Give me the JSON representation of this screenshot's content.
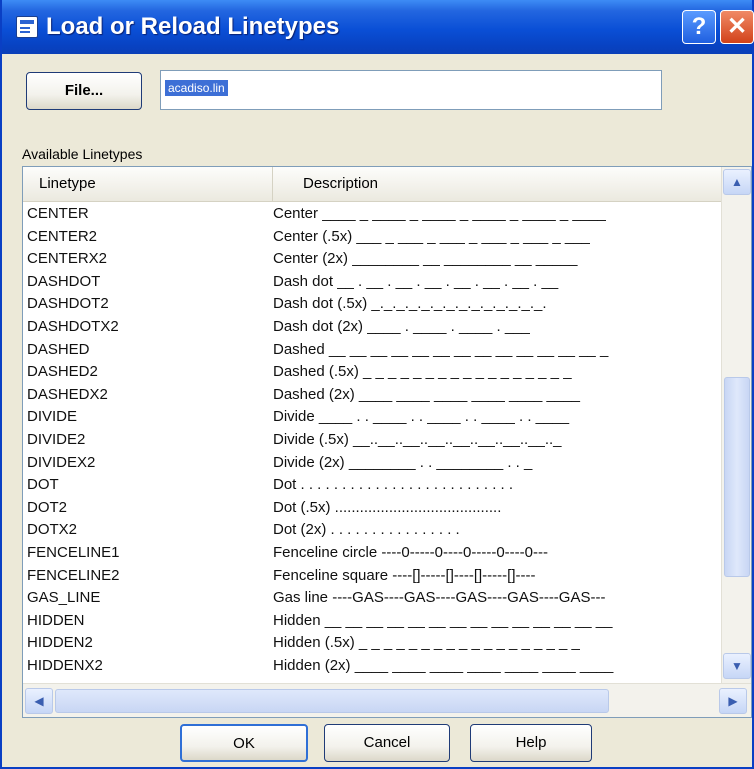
{
  "window": {
    "title": "Load or Reload Linetypes",
    "help_glyph": "?",
    "close_glyph": "✕"
  },
  "file": {
    "button_label": "File...",
    "value": "acadiso.lin"
  },
  "available_label": "Available Linetypes",
  "table": {
    "headers": [
      "Linetype",
      "Description"
    ],
    "rows": [
      {
        "name": "CENTER",
        "desc": "Center ____ _ ____ _ ____ _ ____ _ ____ _ ____"
      },
      {
        "name": "CENTER2",
        "desc": "Center (.5x) ___ _ ___ _ ___ _ ___ _ ___ _ ___"
      },
      {
        "name": "CENTERX2",
        "desc": "Center (2x) ________ __ ________ __ _____"
      },
      {
        "name": "DASHDOT",
        "desc": "Dash dot __ . __ . __ . __ . __ . __ . __ . __"
      },
      {
        "name": "DASHDOT2",
        "desc": "Dash dot (.5x) _._._._._._._._._._._._._._."
      },
      {
        "name": "DASHDOTX2",
        "desc": "Dash dot (2x) ____ . ____ . ____ . ___"
      },
      {
        "name": "DASHED",
        "desc": "Dashed __ __ __ __ __ __ __ __ __ __ __ __ __ _"
      },
      {
        "name": "DASHED2",
        "desc": "Dashed (.5x) _ _ _ _ _ _ _ _ _ _ _ _ _ _ _ _ _"
      },
      {
        "name": "DASHEDX2",
        "desc": "Dashed (2x) ____ ____ ____ ____ ____ ____"
      },
      {
        "name": "DIVIDE",
        "desc": "Divide ____ . . ____ . . ____ . . ____ . . ____"
      },
      {
        "name": "DIVIDE2",
        "desc": "Divide (.5x) __..__..__..__..__..__..__..__.._"
      },
      {
        "name": "DIVIDEX2",
        "desc": "Divide (2x) ________ . . ________ . . _"
      },
      {
        "name": "DOT",
        "desc": "Dot . . . . . . . . . . . . . . . . . . . . . . . . . ."
      },
      {
        "name": "DOT2",
        "desc": "Dot (.5x) ........................................"
      },
      {
        "name": "DOTX2",
        "desc": "Dot (2x) . . . . . . . . . . . . . . . ."
      },
      {
        "name": "FENCELINE1",
        "desc": "Fenceline circle ----0-----0----0-----0----0---"
      },
      {
        "name": "FENCELINE2",
        "desc": "Fenceline square ----[]-----[]----[]-----[]----"
      },
      {
        "name": "GAS_LINE",
        "desc": "Gas line ----GAS----GAS----GAS----GAS----GAS---"
      },
      {
        "name": "HIDDEN",
        "desc": "Hidden __ __ __ __ __ __ __ __ __ __ __ __ __ __"
      },
      {
        "name": "HIDDEN2",
        "desc": "Hidden (.5x) _ _ _ _ _ _ _ _ _ _ _ _ _ _ _ _ _ _"
      },
      {
        "name": "HIDDENX2",
        "desc": "Hidden (2x) ____ ____ ____ ____ ____ ____ ____"
      }
    ]
  },
  "buttons": {
    "ok": "OK",
    "cancel": "Cancel",
    "help": "Help"
  },
  "scroll_arrows": {
    "up": "▲",
    "down": "▼",
    "left": "◀",
    "right": "▶"
  }
}
